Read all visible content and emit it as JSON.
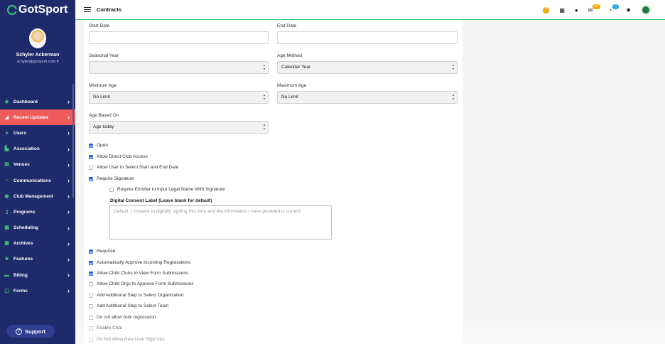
{
  "brand": {
    "name": "GotSport"
  },
  "user": {
    "name": "Schyler Ackerman",
    "email": "schyler@gotsport.com ▾"
  },
  "sidebar": {
    "items": [
      {
        "label": "Dashboard",
        "icon": "dashboard-icon"
      },
      {
        "label": "Recent Updates",
        "icon": "megaphone-icon",
        "active": true
      },
      {
        "label": "Users",
        "icon": "users-icon"
      },
      {
        "label": "Association",
        "icon": "sitemap-icon"
      },
      {
        "label": "Venues",
        "icon": "map-icon"
      },
      {
        "label": "Communications",
        "icon": "chat-icon"
      },
      {
        "label": "Club Management",
        "icon": "clubs-icon"
      },
      {
        "label": "Programs",
        "icon": "document-icon"
      },
      {
        "label": "Scheduling",
        "icon": "calendar-icon"
      },
      {
        "label": "Archives",
        "icon": "archive-icon"
      },
      {
        "label": "Features",
        "icon": "star-icon"
      },
      {
        "label": "Billing",
        "icon": "billing-icon"
      },
      {
        "label": "Forms",
        "icon": "form-icon"
      }
    ],
    "support_label": "Support"
  },
  "topbar": {
    "title": "Contracts",
    "mail_count": "24",
    "chat_count": "1"
  },
  "form": {
    "start_date": {
      "label": "Start Date",
      "value": ""
    },
    "end_date": {
      "label": "End Date",
      "value": ""
    },
    "seasonal_year": {
      "label": "Seasonal Year",
      "value": ""
    },
    "age_method": {
      "label": "Age Method",
      "value": "Calendar Year"
    },
    "minimum_age": {
      "label": "Minimum Age",
      "value": "No Limit"
    },
    "maximum_age": {
      "label": "Maximum Age",
      "value": "No Limit"
    },
    "age_based_on": {
      "label": "Age Based On",
      "value": "Age today"
    },
    "checkboxes": [
      {
        "label": "Open",
        "checked": true
      },
      {
        "label": "Allow Direct Club Access",
        "checked": true
      },
      {
        "label": "Allow User to Select Start and End Date",
        "checked": false
      },
      {
        "label": "Require Signature",
        "checked": true
      },
      {
        "label": "Require Enroller to Input Legal Name With Signature",
        "checked": false
      },
      {
        "label": "Required",
        "checked": true
      },
      {
        "label": "Automatically Approve Incoming Registrations",
        "checked": true
      },
      {
        "label": "Allow Child Clubs to View Form Submissions",
        "checked": true
      },
      {
        "label": "Allow Child Orgs to Approve Form Submissions",
        "checked": false
      },
      {
        "label": "Add Additional Step to Select Organization",
        "checked": false
      },
      {
        "label": "Add Additional Step to Select Team",
        "checked": false
      },
      {
        "label": "Do not allow bulk registration",
        "checked": false
      },
      {
        "label": "Enable Chat",
        "checked": false
      },
      {
        "label": "Do Not Allow New User Sign Ups",
        "checked": false
      }
    ],
    "consent": {
      "label": "Digital Consent Label (Leave blank for default)",
      "placeholder": "Default: I consent to digitally signing this form and the information I have provided is correct."
    }
  }
}
